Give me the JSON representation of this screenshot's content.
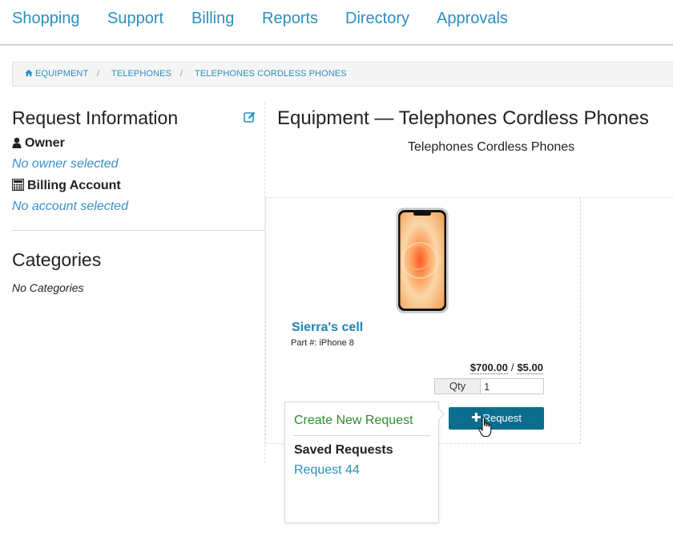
{
  "nav": {
    "items": [
      {
        "label": "Shopping"
      },
      {
        "label": "Support"
      },
      {
        "label": "Billing"
      },
      {
        "label": "Reports"
      },
      {
        "label": "Directory"
      },
      {
        "label": "Approvals"
      }
    ]
  },
  "breadcrumb": {
    "items": [
      "EQUIPMENT",
      "TELEPHONES",
      "TELEPHONES CORDLESS PHONES"
    ],
    "separator": "/",
    "home_icon": "home-icon"
  },
  "sidebar": {
    "title": "Request Information",
    "edit_icon": "edit-icon",
    "owner_label": "Owner",
    "owner_icon": "user-icon",
    "owner_value": "No owner selected",
    "billing_label": "Billing Account",
    "billing_icon": "calculator-icon",
    "billing_value": "No account selected",
    "categories_title": "Categories",
    "categories_empty": "No Categories"
  },
  "main": {
    "title": "Equipment — Telephones Cordless Phones",
    "subtitle": "Telephones Cordless Phones"
  },
  "product": {
    "name": "Sierra's cell",
    "part": "Part #: iPhone 8",
    "price": "$700.00",
    "price_separator": "/",
    "monthly": "$5.00",
    "qty_label": "Qty",
    "qty_value": "1",
    "request_label": "Request",
    "plus_glyph": "✚"
  },
  "dropdown": {
    "create": "Create New Request",
    "saved_heading": "Saved Requests",
    "items": [
      "Request 44"
    ]
  },
  "colors": {
    "link": "#2a8fbf",
    "button": "#0b6e8e",
    "create": "#2e8b2e"
  }
}
